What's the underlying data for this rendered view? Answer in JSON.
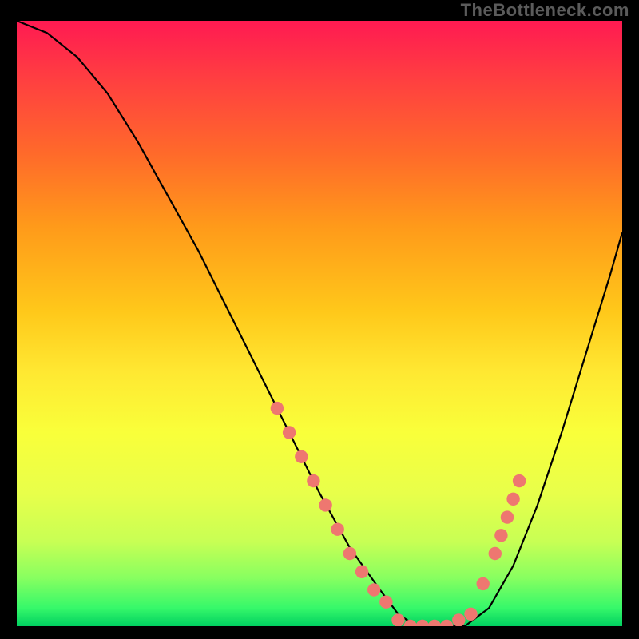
{
  "watermark": "TheBottleneck.com",
  "chart_data": {
    "type": "line",
    "title": "",
    "xlabel": "",
    "ylabel": "",
    "xlim": [
      0,
      100
    ],
    "ylim": [
      0,
      100
    ],
    "grid": false,
    "series": [
      {
        "name": "curve",
        "x": [
          0,
          5,
          10,
          15,
          20,
          25,
          30,
          35,
          40,
          45,
          50,
          55,
          60,
          63,
          66,
          70,
          74,
          78,
          82,
          86,
          90,
          94,
          98,
          100
        ],
        "y": [
          100,
          98,
          94,
          88,
          80,
          71,
          62,
          52,
          42,
          32,
          22,
          13,
          6,
          2,
          0,
          0,
          0,
          3,
          10,
          20,
          32,
          45,
          58,
          65
        ],
        "color": "#000000"
      }
    ],
    "markers": [
      {
        "name": "dots-left",
        "color": "#ee7770",
        "x": [
          43,
          45,
          47,
          49,
          51,
          53,
          55,
          57,
          59,
          61
        ],
        "y": [
          36,
          32,
          28,
          24,
          20,
          16,
          12,
          9,
          6,
          4
        ]
      },
      {
        "name": "dots-bottom",
        "color": "#ee7770",
        "x": [
          63,
          65,
          67,
          69,
          71,
          73,
          75
        ],
        "y": [
          1,
          0,
          0,
          0,
          0,
          1,
          2
        ]
      },
      {
        "name": "dots-right",
        "color": "#ee7770",
        "x": [
          77,
          79,
          80,
          81,
          82,
          83
        ],
        "y": [
          7,
          12,
          15,
          18,
          21,
          24
        ]
      }
    ]
  }
}
